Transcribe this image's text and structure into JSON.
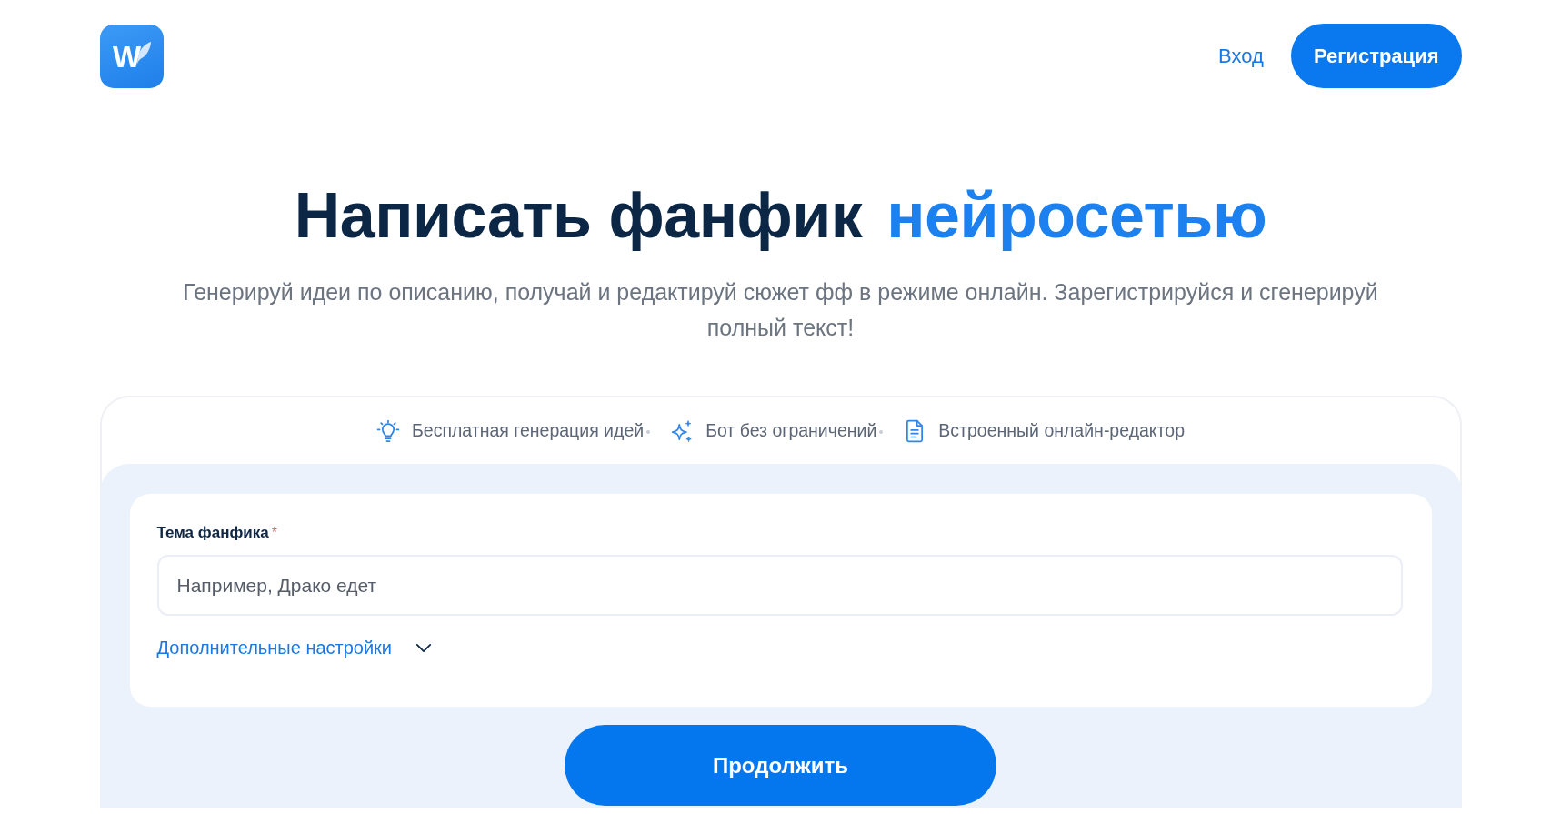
{
  "header": {
    "logo_letter": "W",
    "login": "Вход",
    "register": "Регистрация"
  },
  "hero": {
    "title": [
      {
        "text": "Написать фанфик",
        "accent": false
      },
      {
        "text": "нейросетью",
        "accent": true
      }
    ],
    "subtitle": "Генерируй идеи по описанию, получай и редактируй сюжет фф в режиме онлайн. Зарегистрируйся и сгенерируй полный текст!"
  },
  "features": [
    {
      "kind": "ideas",
      "label": "Бесплатная генерация идей"
    },
    {
      "kind": "bot",
      "label": "Бот без ограничений"
    },
    {
      "kind": "editor",
      "label": "Встроенный онлайн-редактор"
    }
  ],
  "form": {
    "topic": {
      "label": "Тема фанфика",
      "required_mark": "*",
      "placeholder": "Например, Драко едет"
    },
    "more_settings": {
      "label": "Дополнительные настройки",
      "expanded": false
    },
    "submit": "Продолжить"
  }
}
